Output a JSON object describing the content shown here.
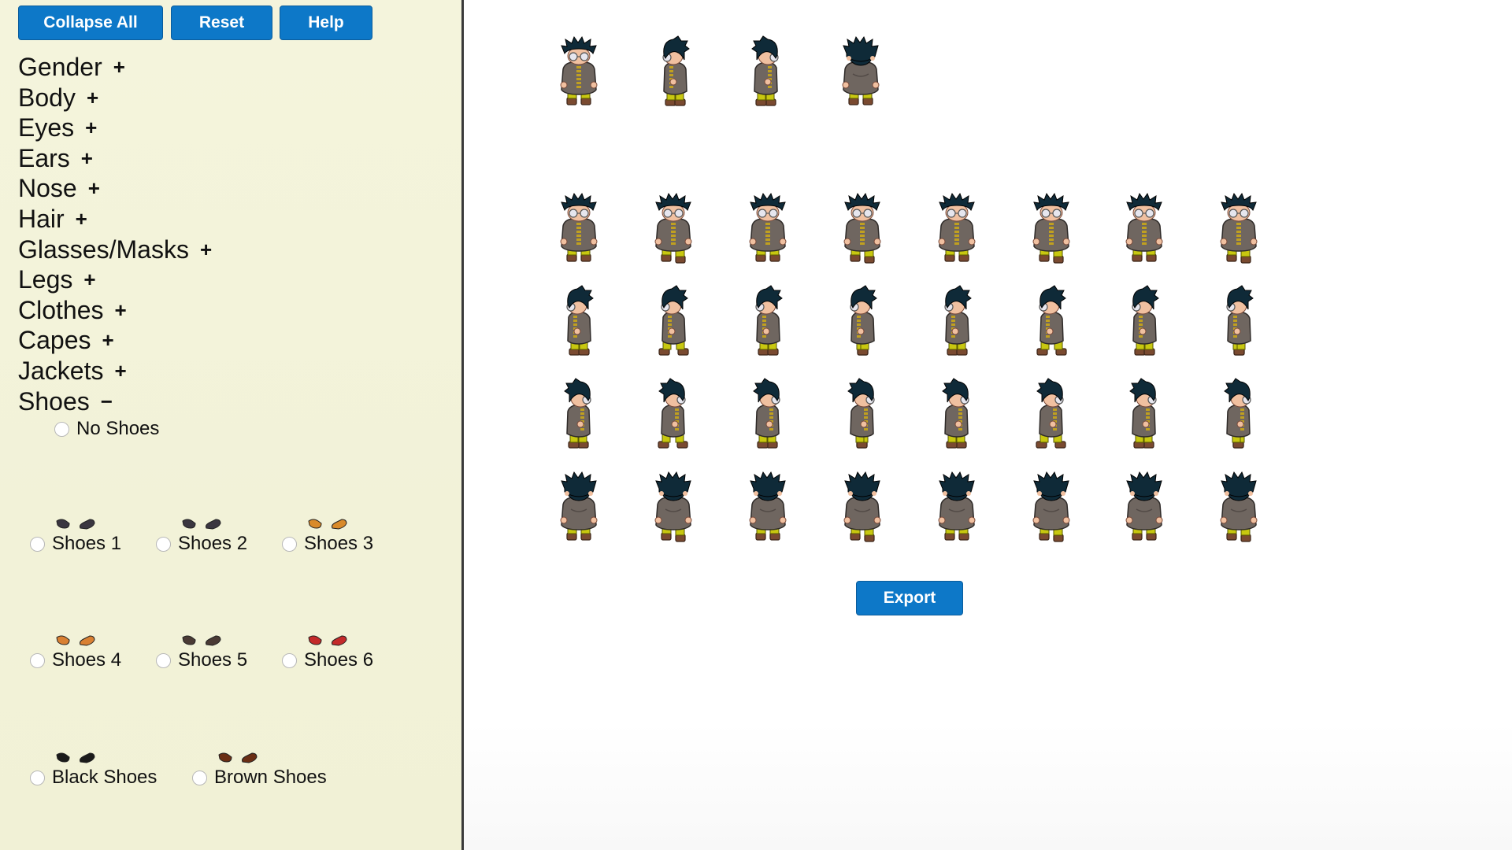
{
  "toolbar": {
    "collapse_all_label": "Collapse All",
    "reset_label": "Reset",
    "help_label": "Help"
  },
  "sections": [
    {
      "label": "Gender",
      "toggle": "+",
      "expanded": false
    },
    {
      "label": "Body",
      "toggle": "+",
      "expanded": false
    },
    {
      "label": "Eyes",
      "toggle": "+",
      "expanded": false
    },
    {
      "label": "Ears",
      "toggle": "+",
      "expanded": false
    },
    {
      "label": "Nose",
      "toggle": "+",
      "expanded": false
    },
    {
      "label": "Hair",
      "toggle": "+",
      "expanded": false
    },
    {
      "label": "Glasses/Masks",
      "toggle": "+",
      "expanded": false
    },
    {
      "label": "Legs",
      "toggle": "+",
      "expanded": false
    },
    {
      "label": "Clothes",
      "toggle": "+",
      "expanded": false
    },
    {
      "label": "Capes",
      "toggle": "+",
      "expanded": false
    },
    {
      "label": "Jackets",
      "toggle": "+",
      "expanded": false
    },
    {
      "label": "Shoes",
      "toggle": "−",
      "expanded": true
    }
  ],
  "shoes": {
    "no_shoes_label": "No Shoes",
    "options": [
      {
        "label": "Shoes 1",
        "color": "#3a3640",
        "checked": false
      },
      {
        "label": "Shoes 2",
        "color": "#3a3640",
        "checked": false
      },
      {
        "label": "Shoes 3",
        "color": "#d98a2a",
        "checked": false
      },
      {
        "label": "Shoes 4",
        "color": "#d98032",
        "checked": false
      },
      {
        "label": "Shoes 5",
        "color": "#4a3a34",
        "checked": false
      },
      {
        "label": "Shoes 6",
        "color": "#c42a2a",
        "checked": false
      },
      {
        "label": "Black Shoes",
        "color": "#1a1a1a",
        "checked": false
      },
      {
        "label": "Brown Shoes",
        "color": "#6a2e14",
        "checked": false
      }
    ]
  },
  "preview": {
    "top_row_directions": [
      "front",
      "left",
      "right",
      "back"
    ],
    "grid_rows": [
      {
        "direction": "front",
        "frames": 8
      },
      {
        "direction": "left",
        "frames": 8
      },
      {
        "direction": "right",
        "frames": 8
      },
      {
        "direction": "back",
        "frames": 8
      }
    ]
  },
  "export_label": "Export",
  "colors": {
    "button_blue": "#0d78c8",
    "sidebar_bg": "#f4f4dc",
    "hair": "#0f2a38",
    "coat": "#6f6660",
    "pants": "#c8c810",
    "shoes": "#7a4a30",
    "skin": "#f0c0a0"
  }
}
